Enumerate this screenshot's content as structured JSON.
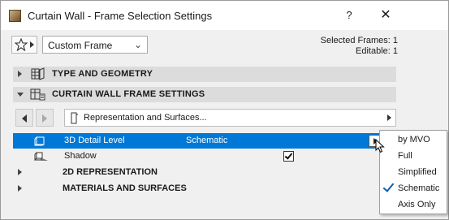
{
  "window": {
    "title": "Curtain Wall - Frame Selection Settings",
    "help_label": "?",
    "close_label": "✕"
  },
  "toolbar": {
    "favorites_icon": "star-icon",
    "preset": "Custom Frame",
    "selected_frames": "Selected Frames: 1",
    "editable": "Editable: 1"
  },
  "sections": {
    "type_geometry": "TYPE AND GEOMETRY",
    "frame_settings": "CURTAIN WALL FRAME SETTINGS"
  },
  "panel": {
    "title": "Representation and Surfaces..."
  },
  "rows": {
    "detail_level": {
      "name": "3D Detail Level",
      "value": "Schematic"
    },
    "shadow": {
      "name": "Shadow",
      "checked": true
    },
    "rep_2d": "2D REPRESENTATION",
    "materials": "MATERIALS AND SURFACES"
  },
  "menu": {
    "items": [
      "by MVO",
      "Full",
      "Simplified",
      "Schematic",
      "Axis Only"
    ],
    "checked": "Schematic"
  },
  "colors": {
    "selection": "#0078d7",
    "section_bg": "#dcdcdc",
    "dialog_bg": "#f0f0f0"
  }
}
